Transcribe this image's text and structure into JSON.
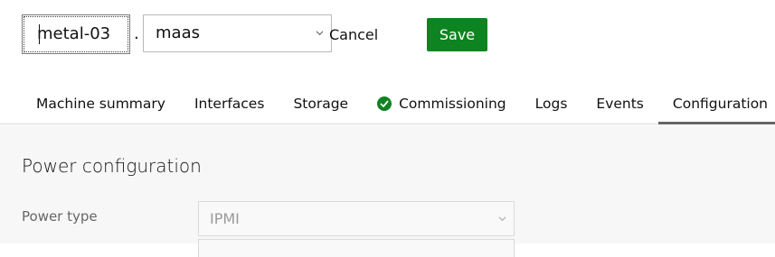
{
  "hostname": {
    "value": "metal-03"
  },
  "separator": ".",
  "domain": {
    "value": "maas"
  },
  "actions": {
    "cancel_label": "Cancel",
    "save_label": "Save"
  },
  "tabs": [
    {
      "label": "Machine summary"
    },
    {
      "label": "Interfaces"
    },
    {
      "label": "Storage"
    },
    {
      "label": "Commissioning",
      "icon": "success-tick-icon"
    },
    {
      "label": "Logs"
    },
    {
      "label": "Events"
    },
    {
      "label": "Configuration",
      "active": true
    }
  ],
  "power": {
    "section_title": "Power configuration",
    "type_label": "Power type",
    "type_value": "IPMI"
  },
  "colors": {
    "accent": "#0e8420",
    "active_tab_underline": "#666666"
  }
}
